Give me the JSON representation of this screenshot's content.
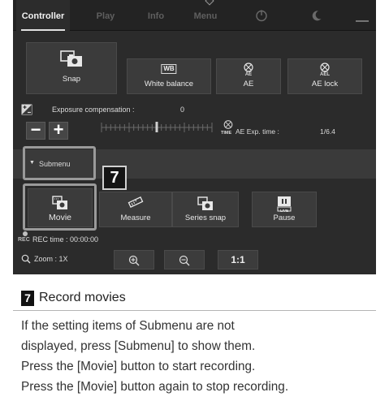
{
  "tabs": [
    {
      "label": "Controller",
      "active": true
    },
    {
      "label": "Play"
    },
    {
      "label": "Info"
    },
    {
      "label": "Menu"
    },
    {
      "icon": "power-icon"
    },
    {
      "icon": "moon-icon"
    },
    {
      "icon": "minimize-icon"
    }
  ],
  "buttons": {
    "snap": "Snap",
    "white_balance": "White balance",
    "wb_badge": "WB",
    "ae": "AE",
    "ae_icon_text": "AE",
    "ae_lock": "AE lock",
    "ae_lock_icon_text": "AEL"
  },
  "exposure": {
    "label": "Exposure compensation :",
    "value": "0",
    "minus": "−",
    "plus": "+",
    "position": 0.5
  },
  "ae_exp": {
    "icon_text": "TIME",
    "label": "AE Exp. time :",
    "value": "1/6.4"
  },
  "submenu": {
    "arrow": "▼",
    "label": "Submenu"
  },
  "sub_buttons": {
    "movie": "Movie",
    "measure": "Measure",
    "series_snap": "Series snap",
    "pause": "Pause",
    "live_text": "LIVE"
  },
  "rec": {
    "icon_text": "REC",
    "label": "REC time : 00:00:00"
  },
  "zoom": {
    "label": "Zoom : 1X",
    "one_to_one": "1:1"
  },
  "callout_number": "7",
  "doc": {
    "number": "7",
    "title": "Record movies",
    "lines": [
      "If the setting items of Submenu are not",
      "displayed, press [Submenu] to show them.",
      "Press the [Movie] button to start recording.",
      "Press the [Movie] button again to stop recording."
    ]
  },
  "colors": {
    "panel": "#2b2b2b",
    "tabbar": "#232323",
    "button": "#3b3b3b",
    "callout": "#9a9a9a"
  }
}
